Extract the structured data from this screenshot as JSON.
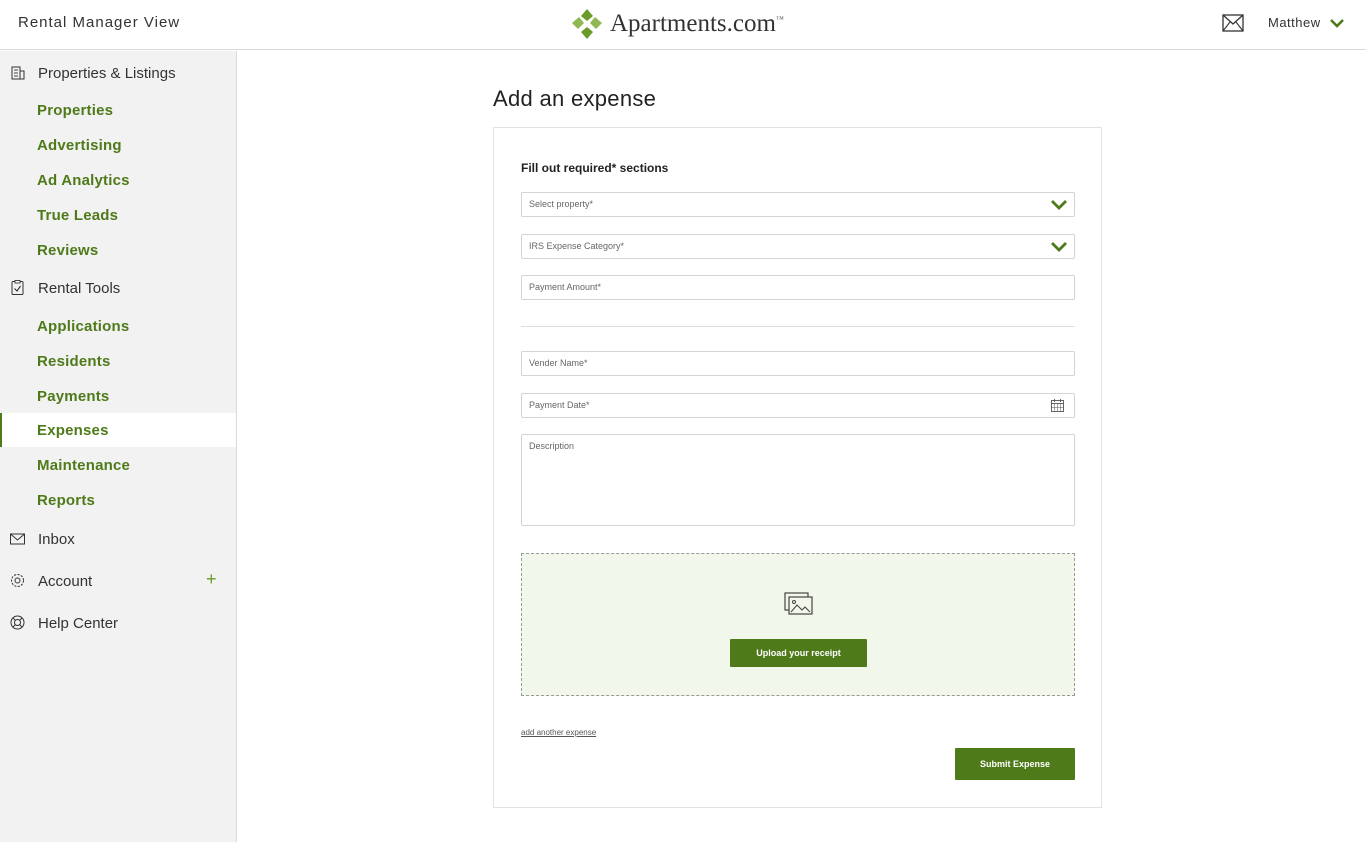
{
  "header": {
    "view_title": "Rental Manager View",
    "logo_text": "Apartments.com",
    "logo_tm": "™",
    "user_name": "Matthew",
    "accent_color": "#4e7a1a"
  },
  "sidebar": {
    "sections": [
      {
        "label": "Properties & Listings",
        "icon": "building-icon"
      },
      {
        "label": "Rental Tools",
        "icon": "clipboard-check-icon"
      },
      {
        "label": "Inbox",
        "icon": "envelope-icon"
      },
      {
        "label": "Account",
        "icon": "gear-icon",
        "expand": "+"
      },
      {
        "label": "Help Center",
        "icon": "lifebuoy-icon"
      }
    ],
    "listing_items": [
      "Properties",
      "Advertising",
      "Ad Analytics",
      "True Leads",
      "Reviews"
    ],
    "tool_items": [
      "Applications",
      "Residents",
      "Payments",
      "Expenses",
      "Maintenance",
      "Reports"
    ],
    "active_item": "Expenses"
  },
  "main": {
    "title": "Add an expense",
    "form_heading": "Fill out required* sections",
    "fields": {
      "property": "Select property*",
      "category": "IRS Expense Category*",
      "amount": "Payment Amount*",
      "vendor": "Vender Name*",
      "date": "Payment Date*",
      "description": "Description"
    },
    "upload_button": "Upload your receipt",
    "add_another": "add another expense",
    "submit_button": "Submit Expense"
  }
}
